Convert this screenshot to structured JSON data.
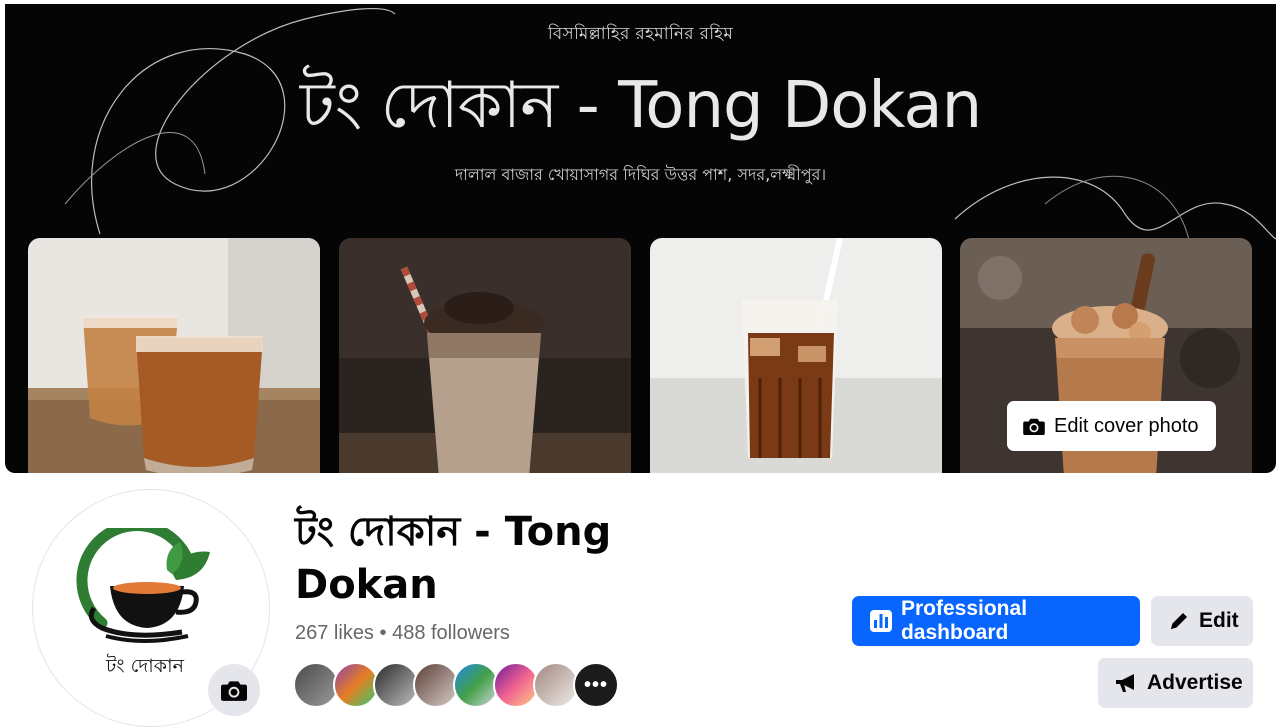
{
  "cover": {
    "top_line": "বিসমিল্লাহির রহমানির রহিম",
    "title": "টং দোকান - Tong Dokan",
    "address": "দালাল বাজার খোয়াসাগর দিঘির উত্তর পাশ, সদর,লক্ষ্মীপুর।",
    "edit_button": "Edit cover photo",
    "photos": [
      "iced-tea-glasses",
      "chocolate-frappe",
      "iced-coffee",
      "cookie-shake"
    ]
  },
  "profile": {
    "logo_text": "টং দোকান",
    "name": "টং দোকান - Tong Dokan",
    "likes": "267 likes",
    "separator": "•",
    "followers": "488 followers",
    "follower_avatars": [
      "follower-1",
      "follower-2",
      "follower-3",
      "follower-4",
      "follower-5",
      "follower-6",
      "follower-7"
    ],
    "more_followers": "•••"
  },
  "actions": {
    "dashboard": "Professional dashboard",
    "edit": "Edit",
    "advertise": "Advertise"
  },
  "colors": {
    "primary": "#0866ff",
    "secondary_bg": "#e4e6eb",
    "muted_text": "#65676b",
    "logo_green": "#2e7d32",
    "logo_orange": "#e07a34"
  }
}
